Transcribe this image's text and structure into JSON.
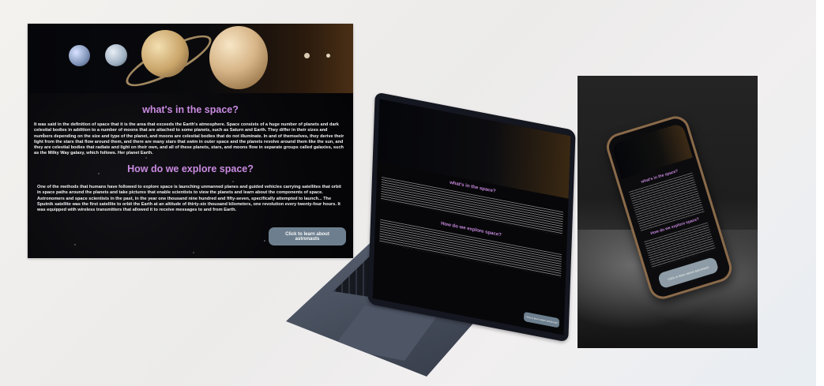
{
  "desktop": {
    "heading1": "what's in the space?",
    "paragraph1": "It was said in the definition of space that it is the area that exceeds the Earth's atmosphere. Space consists of a huge number of planets and dark celestial bodies in addition to a number of moons that are attached to some planets, such as Saturn and Earth. They differ in their sizes and numbers depending on the size and type of the planet, and moons are celestial bodies that do not illuminate. In and of themselves, they derive their light from the stars that flow around them, and there are many stars that swim in outer space and the planets revolve around them like the sun, and they are celestial bodies that radiate and light on their own, and all of these planets, stars, and moons flow in separate groups called galaxies, such as the Milky Way galaxy, which follows. Her planet Earth.",
    "heading2": "How do we explore space?",
    "paragraph2": "One of the methods that humans have followed to explore space is launching unmanned planes and guided vehicles carrying satellites that orbit in space paths around the planets and take pictures that enable scientists to view the planets and learn about the components of space. Astronomers and space scientists in the past, in the year one thousand nine hundred and fifty-seven, specifically attempted to launch... The Sputnik satellite was the first satellite to orbit the Earth at an altitude of thirty-six thousand kilometers, one revolution every twenty-four hours. It was equipped with wireless transmitters that allowed it to receive messages to and from Earth.",
    "button": "Click to learn about astronauts"
  },
  "laptop": {
    "heading1": "what's in the space?",
    "heading2": "How do we explore space?",
    "button": "Click to learn about astronauts"
  },
  "phone": {
    "heading1": "what's in the space?",
    "heading2": "How do we explore space?",
    "button": "Click to learn about astronauts"
  }
}
